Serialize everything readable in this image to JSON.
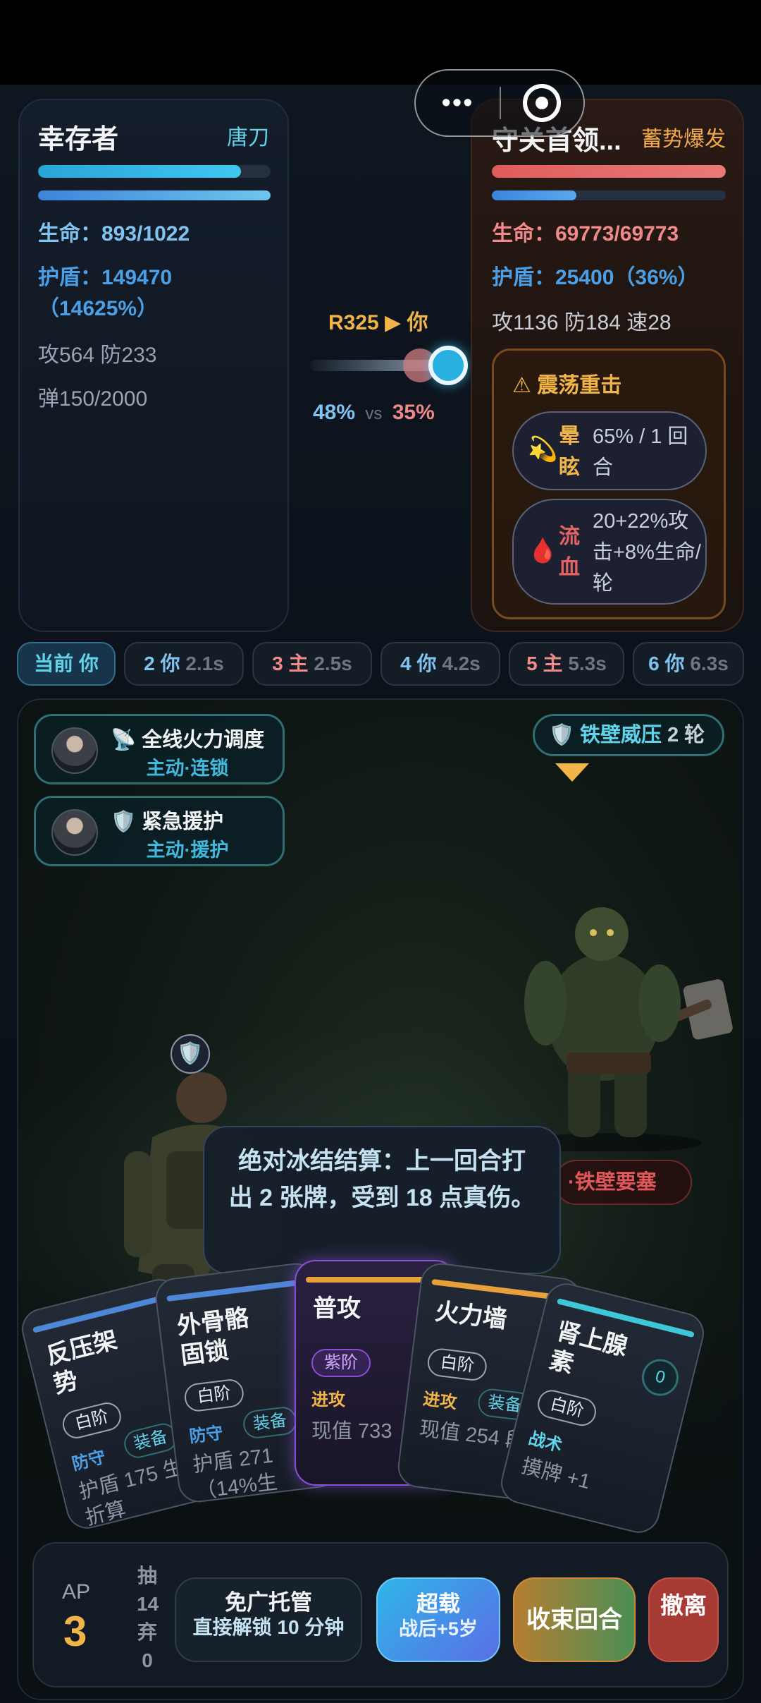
{
  "capsule": {
    "more_label": "•••",
    "close_label": "close"
  },
  "player": {
    "title": "幸存者",
    "weapon": "唐刀",
    "hp_fraction": 0.873,
    "shield_fraction": 1.0,
    "hp": "生命：893/1022",
    "shield_line1": "护盾：149470",
    "shield_line2": "（14625%）",
    "attack_defense": "攻564   防233",
    "ammo": "弹150/2000"
  },
  "enemy": {
    "title": "守关首领...",
    "tag": "蓄势爆发",
    "hp_fraction": 1.0,
    "shield_fraction": 0.36,
    "hp": "生命：69773/69773",
    "shield": "护盾：25400（36%）",
    "stats": "攻1136   防184   速28",
    "warning_title": "⚠ 震荡重击",
    "statuses": [
      {
        "icon": "💫",
        "name": "晕眩",
        "desc": "65% / 1 回合"
      },
      {
        "icon": "🩸",
        "name": "流血",
        "desc": "20+22%攻击+8%生命/轮"
      }
    ]
  },
  "turn": {
    "label": "R325 ▶ 你",
    "player_pct": "48%",
    "vs": "vs",
    "enemy_pct": "35%"
  },
  "timeline": [
    {
      "label": "当前 你",
      "time": ""
    },
    {
      "label": "2 你",
      "time": "2.1s"
    },
    {
      "label": "3 主",
      "time": "2.5s"
    },
    {
      "label": "4 你",
      "time": "4.2s"
    },
    {
      "label": "5 主",
      "time": "5.3s"
    },
    {
      "label": "6 你",
      "time": "6.3s"
    }
  ],
  "battle": {
    "skills": [
      {
        "icon": "📡",
        "name": "全线火力调度",
        "sub": "主动·连锁"
      },
      {
        "icon": "🛡️",
        "name": "紧急援护",
        "sub": "主动·援护"
      }
    ],
    "buff": {
      "icon": "🛡️",
      "name": "铁壁威压",
      "count": "2 轮"
    },
    "hero_shield_icon": "🛡️",
    "enemy_tag": "·铁壁要塞",
    "tooltip": "绝对冰结结算：上一回合打出 2 张牌，受到 18 点真伤。"
  },
  "cards": [
    {
      "title": "反压架势",
      "rarity": "白阶",
      "type": "防守",
      "subtype": "装备",
      "desc": "护盾 175 生命折算",
      "accent": "#4f86d6"
    },
    {
      "title": "外骨骼固锁",
      "rarity": "白阶",
      "type": "防守",
      "subtype": "装备",
      "desc": "护盾 271（14%生",
      "accent": "#4f86d6"
    },
    {
      "title": "普攻",
      "rarity": "紫阶",
      "type": "进攻",
      "subtype": "",
      "desc": "现值 733",
      "accent": "#e8a13a"
    },
    {
      "title": "火力墙",
      "rarity": "白阶",
      "type": "进攻",
      "subtype": "装备",
      "desc": "现值 254 段",
      "accent": "#e8a13a"
    },
    {
      "title": "肾上腺素",
      "rarity": "白阶",
      "type": "战术",
      "subtype": "",
      "desc": "摸牌 +1",
      "cost": "0",
      "accent": "#3fc6d8"
    }
  ],
  "bottom": {
    "ap_label": "AP",
    "ap_value": "3",
    "draw_label": "抽",
    "draw_value": "14",
    "discard_label": "弃",
    "discard_value": "0",
    "ads_l1": "免广托管",
    "ads_l2": "直接解锁 10 分钟",
    "super_l1": "超载",
    "super_l2": "战后+5岁",
    "end_turn": "收束回合",
    "leave": "撤离"
  },
  "colors": {
    "hp_player": "#35b8e8",
    "shield_player": "#4a9fe6",
    "hp_enemy": "#e46466",
    "shield_enemy": "#4a86d8",
    "accent_gold": "#f1b447",
    "player_blue": "#7fc4f0",
    "enemy_red": "#f08a8a"
  }
}
